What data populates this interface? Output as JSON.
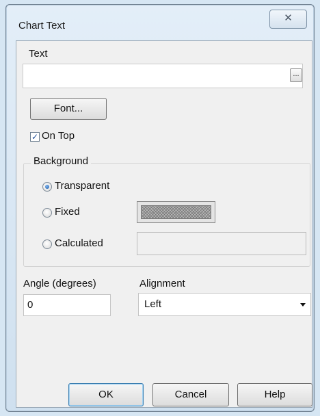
{
  "window": {
    "title": "Chart Text",
    "close_glyph": "✕"
  },
  "text_field": {
    "label": "Text",
    "value": "",
    "browse_label": "..."
  },
  "font_button": {
    "label": "Font..."
  },
  "on_top": {
    "label": "On Top",
    "checked": true,
    "check_glyph": "✓"
  },
  "background": {
    "legend": "Background",
    "options": [
      {
        "label": "Transparent",
        "selected": true
      },
      {
        "label": "Fixed",
        "selected": false
      },
      {
        "label": "Calculated",
        "selected": false
      }
    ],
    "fixed_color": "#b8b8b8",
    "calculated_value": ""
  },
  "angle": {
    "label": "Angle (degrees)",
    "value": "0"
  },
  "alignment": {
    "label": "Alignment",
    "selected": "Left"
  },
  "buttons": {
    "ok": "OK",
    "cancel": "Cancel",
    "help": "Help"
  }
}
